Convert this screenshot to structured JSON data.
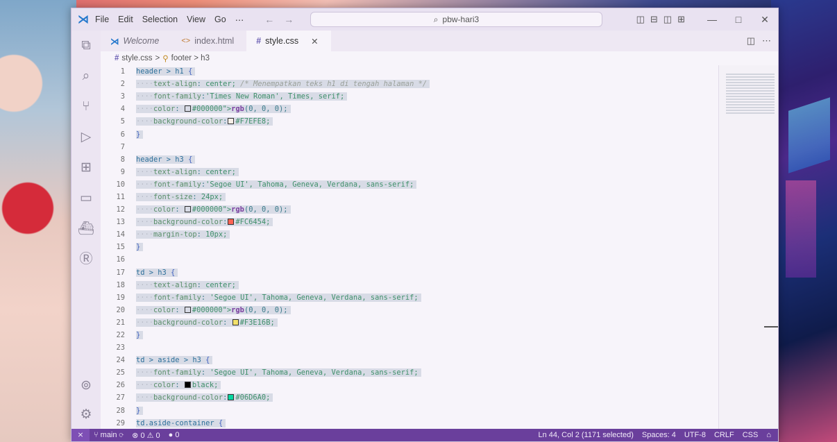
{
  "titlebar": {
    "menu": [
      "File",
      "Edit",
      "Selection",
      "View",
      "Go",
      "⋯"
    ],
    "search": "pbw-hari3",
    "layout_icons": [
      "◫",
      "⊟",
      "◫",
      "⊞"
    ],
    "min": "—",
    "max": "□",
    "close": "✕"
  },
  "tabs": [
    {
      "label": "Welcome",
      "icon": "vscode-logo-icon"
    },
    {
      "label": "index.html",
      "icon": "html-file-icon"
    },
    {
      "label": "style.css",
      "icon": "css-file-icon",
      "close": "✕"
    }
  ],
  "breadcrumb": {
    "file": "style.css",
    "sep1": ">",
    "symbol": "footer > h3"
  },
  "status": {
    "branch": "main",
    "sync": "⟳",
    "problems": "⊗ 0 ⚠ 0",
    "ports": "● 0",
    "position": "Ln 44, Col 2 (1171 selected)",
    "spaces": "Spaces: 4",
    "encoding": "UTF-8",
    "eol": "CRLF",
    "lang": "CSS",
    "bell": "⌂"
  },
  "colors": {
    "accent": "#6a3f9c",
    "swatch_f7efe8": "#F7EFE8",
    "swatch_fc6454": "#FC6454",
    "swatch_f3e16b": "#F3E16B",
    "swatch_06d6a0": "#06D6A0",
    "black": "#000000"
  },
  "code_lines": [
    {
      "n": "1",
      "t": "header > h1 {"
    },
    {
      "n": "2",
      "t": "    text-align: center; /* Menempatkan teks h1 di tengah halaman */"
    },
    {
      "n": "3",
      "t": "    font-family:'Times New Roman', Times, serif;"
    },
    {
      "n": "4",
      "t": "    color: rgb(0, 0, 0);"
    },
    {
      "n": "5",
      "t": "    background-color:#F7EFE8;"
    },
    {
      "n": "6",
      "t": "}"
    },
    {
      "n": "7",
      "t": ""
    },
    {
      "n": "8",
      "t": "header > h3 {"
    },
    {
      "n": "9",
      "t": "    text-align: center;"
    },
    {
      "n": "10",
      "t": "    font-family:'Segoe UI', Tahoma, Geneva, Verdana, sans-serif;"
    },
    {
      "n": "11",
      "t": "    font-size: 24px;"
    },
    {
      "n": "12",
      "t": "    color: rgb(0, 0, 0);"
    },
    {
      "n": "13",
      "t": "    background-color:#FC6454;"
    },
    {
      "n": "14",
      "t": "    margin-top: 10px;"
    },
    {
      "n": "15",
      "t": "}"
    },
    {
      "n": "16",
      "t": ""
    },
    {
      "n": "17",
      "t": "td > h3 {"
    },
    {
      "n": "18",
      "t": "    text-align: center;"
    },
    {
      "n": "19",
      "t": "    font-family: 'Segoe UI', Tahoma, Geneva, Verdana, sans-serif;"
    },
    {
      "n": "20",
      "t": "    color: rgb(0, 0, 0);"
    },
    {
      "n": "21",
      "t": "    background-color: #F3E16B;"
    },
    {
      "n": "22",
      "t": "}"
    },
    {
      "n": "23",
      "t": ""
    },
    {
      "n": "24",
      "t": "td > aside > h3 {"
    },
    {
      "n": "25",
      "t": "    font-family: 'Segoe UI', Tahoma, Geneva, Verdana, sans-serif;"
    },
    {
      "n": "26",
      "t": "    color: black;"
    },
    {
      "n": "27",
      "t": "    background-color:#06D6A0;"
    },
    {
      "n": "28",
      "t": "}"
    },
    {
      "n": "29",
      "t": "td.aside-container {"
    }
  ]
}
